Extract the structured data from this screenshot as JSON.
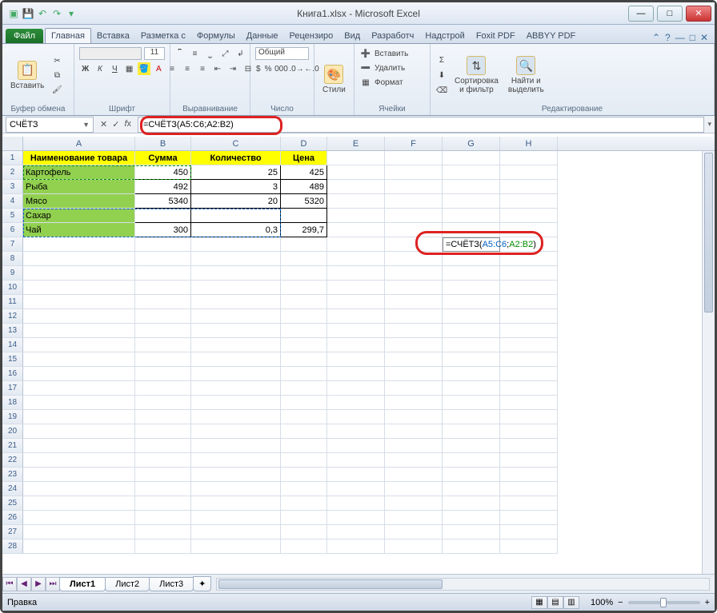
{
  "window": {
    "title": "Книга1.xlsx - Microsoft Excel"
  },
  "tabs": {
    "file": "Файл",
    "list": [
      "Главная",
      "Вставка",
      "Разметка с",
      "Формулы",
      "Данные",
      "Рецензиро",
      "Вид",
      "Разработч",
      "Надстрой",
      "Foxit PDF",
      "ABBYY PDF"
    ],
    "active": "Главная"
  },
  "ribbon": {
    "clipboard": {
      "label": "Буфер обмена",
      "paste": "Вставить"
    },
    "font": {
      "label": "Шрифт",
      "size": "11"
    },
    "alignment": {
      "label": "Выравнивание"
    },
    "number": {
      "label": "Число",
      "format": "Общий"
    },
    "styles": {
      "label": "Стили",
      "btn": "Стили"
    },
    "cells": {
      "label": "Ячейки",
      "insert": "Вставить",
      "delete": "Удалить",
      "format": "Формат"
    },
    "editing": {
      "label": "Редактирование",
      "sort": "Сортировка\nи фильтр",
      "find": "Найти и\nвыделить"
    }
  },
  "namebox": "СЧЁТЗ",
  "formula_bar": "=СЧЁТЗ(A5:C6;A2:B2)",
  "columns": [
    "A",
    "B",
    "C",
    "D",
    "E",
    "F",
    "G",
    "H"
  ],
  "headers": {
    "A": "Наименование товара",
    "B": "Сумма",
    "C": "Количество",
    "D": "Цена"
  },
  "rows": [
    {
      "n": 2,
      "A": "Картофель",
      "B": "450",
      "C": "25",
      "D": "425"
    },
    {
      "n": 3,
      "A": "Рыба",
      "B": "492",
      "C": "3",
      "D": "489"
    },
    {
      "n": 4,
      "A": "Мясо",
      "B": "5340",
      "C": "20",
      "D": "5320"
    },
    {
      "n": 5,
      "A": "Сахар",
      "B": "",
      "C": "",
      "D": ""
    },
    {
      "n": 6,
      "A": "Чай",
      "B": "300",
      "C": "0,3",
      "D": "299,7"
    }
  ],
  "editing_cell": {
    "ref": "G7",
    "prefix": "=СЧЁТЗ(",
    "range1": "A5:C6",
    "sep": ";",
    "range2": "A2:B2",
    "suffix": ")"
  },
  "sheets": [
    "Лист1",
    "Лист2",
    "Лист3"
  ],
  "active_sheet": "Лист1",
  "status": {
    "mode": "Правка",
    "zoom": "100%"
  }
}
